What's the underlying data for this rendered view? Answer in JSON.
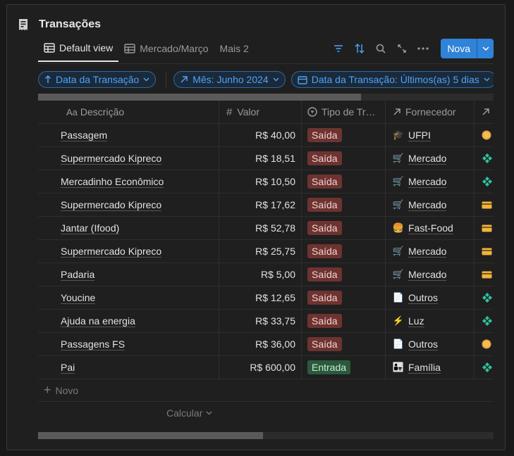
{
  "title": "Transações",
  "tabs": [
    {
      "label": "Default view",
      "icon": "table-icon"
    },
    {
      "label": "Mercado/Março",
      "icon": "table-icon"
    },
    {
      "label": "Mais 2"
    }
  ],
  "actions": {
    "new_label": "Nova"
  },
  "filters": [
    {
      "label": "Data da Transação",
      "icon": "arrow-up-icon"
    },
    {
      "label": "Mês: Junho 2024",
      "icon": "arrow-up-right-icon"
    },
    {
      "label": "Data da Transação: Últimos(as) 5 dias",
      "icon": "calendar-icon"
    }
  ],
  "columns": [
    {
      "label": "Descrição",
      "prefix": "Aa"
    },
    {
      "label": "Valor",
      "prefix": "#"
    },
    {
      "label": "Tipo de Tr…"
    },
    {
      "label": "Fornecedor"
    }
  ],
  "rows": [
    {
      "desc": "Passagem",
      "valor": "R$ 40,00",
      "tipo": "Saída",
      "forn": "UFPI",
      "forn_emoji": "🎓",
      "conta": "coin"
    },
    {
      "desc": "Supermercado Kipreco",
      "valor": "R$ 18,51",
      "tipo": "Saída",
      "forn": "Mercado",
      "forn_emoji": "🛒",
      "conta": "diamond"
    },
    {
      "desc": "Mercadinho Econômico",
      "valor": "R$ 10,50",
      "tipo": "Saída",
      "forn": "Mercado",
      "forn_emoji": "🛒",
      "conta": "diamond"
    },
    {
      "desc": "Supermercado Kipreco",
      "valor": "R$ 17,62",
      "tipo": "Saída",
      "forn": "Mercado",
      "forn_emoji": "🛒",
      "conta": "card"
    },
    {
      "desc": "Jantar (Ifood)",
      "valor": "R$ 52,78",
      "tipo": "Saída",
      "forn": "Fast-Food",
      "forn_emoji": "🍔",
      "conta": "card"
    },
    {
      "desc": "Supermercado Kipreco",
      "valor": "R$ 25,75",
      "tipo": "Saída",
      "forn": "Mercado",
      "forn_emoji": "🛒",
      "conta": "card"
    },
    {
      "desc": "Padaria",
      "valor": "R$ 5,00",
      "tipo": "Saída",
      "forn": "Mercado",
      "forn_emoji": "🛒",
      "conta": "card"
    },
    {
      "desc": "Youcine",
      "valor": "R$ 12,65",
      "tipo": "Saída",
      "forn": "Outros",
      "forn_emoji": "📄",
      "conta": "diamond"
    },
    {
      "desc": "Ajuda na energia",
      "valor": "R$ 33,75",
      "tipo": "Saída",
      "forn": "Luz",
      "forn_emoji": "⚡",
      "conta": "diamond"
    },
    {
      "desc": "Passagens FS",
      "valor": "R$ 36,00",
      "tipo": "Saída",
      "forn": "Outros",
      "forn_emoji": "📄",
      "conta": "coin"
    },
    {
      "desc": "Pai",
      "valor": "R$ 600,00",
      "tipo": "Entrada",
      "forn": "Família",
      "forn_emoji": "👨‍👧",
      "conta": "diamond"
    }
  ],
  "new_row_label": "Novo",
  "calc_label": "Calcular",
  "colors": {
    "accent": "#2f83d8",
    "saida": "#6e3330",
    "entrada": "#2a5a3c"
  }
}
